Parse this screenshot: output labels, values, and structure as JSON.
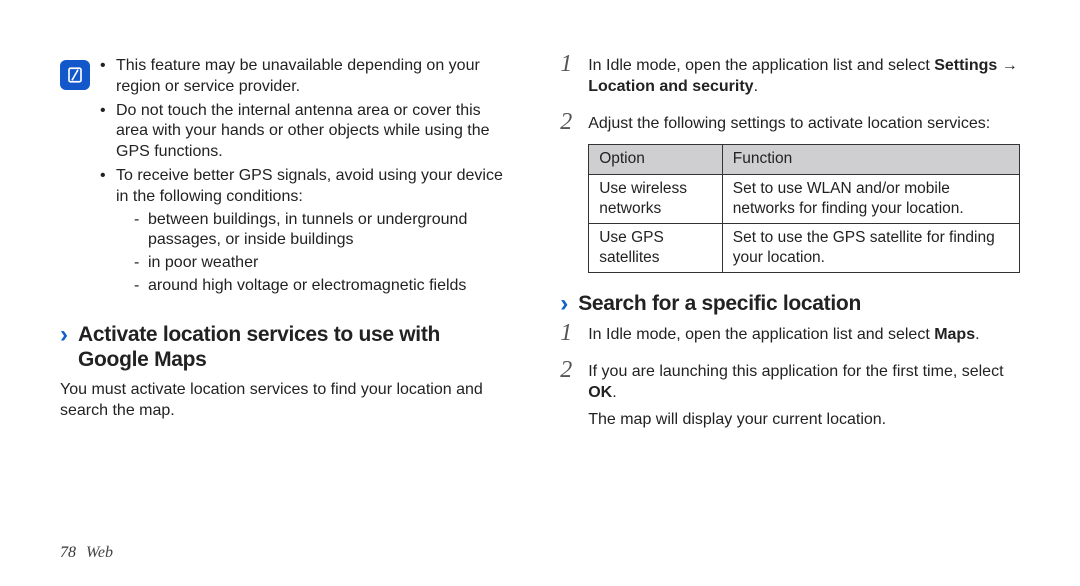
{
  "left": {
    "note_icon_label": "note",
    "tips": [
      "This feature may be unavailable depending on your region or service provider.",
      "Do not touch the internal antenna area or cover this area with your hands or other objects while using the GPS functions.",
      "To receive better GPS signals, avoid using your device in the following conditions:"
    ],
    "sub_tips": [
      "between buildings, in tunnels or underground passages, or inside buildings",
      "in poor weather",
      "around high voltage or electromagnetic fields"
    ],
    "section_title": "Activate location services to use with Google Maps",
    "section_lead": "You must activate location services to find your location and search the map."
  },
  "right": {
    "steps_a": [
      {
        "pre": "In Idle mode, open the application list and select ",
        "bold": "Settings → Location and security",
        "post": "."
      },
      {
        "pre": "Adjust the following settings to activate location services:",
        "bold": "",
        "post": ""
      }
    ],
    "table": {
      "head_option": "Option",
      "head_function": "Function",
      "rows": [
        {
          "opt": "Use wireless networks",
          "fn": "Set to use WLAN and/or mobile networks for finding your location."
        },
        {
          "opt": "Use GPS satellites",
          "fn": "Set to use the GPS satellite for finding your location."
        }
      ]
    },
    "section_title": "Search for a specific location",
    "steps_b": [
      {
        "pre": "In Idle mode, open the application list and select ",
        "bold": "Maps",
        "post": "."
      },
      {
        "pre": "If you are launching this application for the first time, select ",
        "bold": "OK",
        "post": "."
      }
    ],
    "after_b": "The map will display your current location."
  },
  "footer": {
    "page_number": "78",
    "section_name": "Web"
  }
}
